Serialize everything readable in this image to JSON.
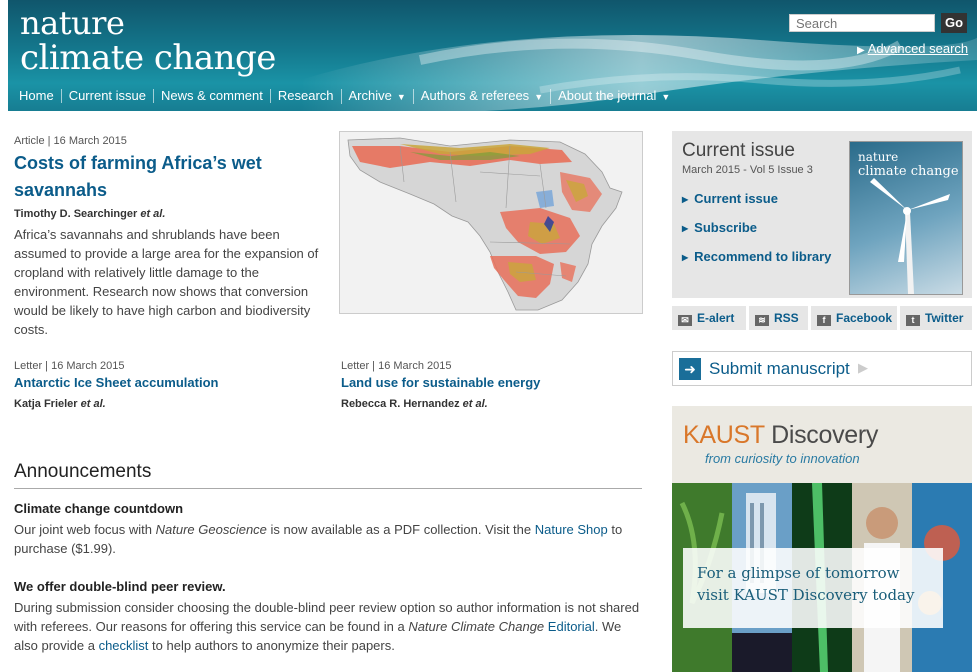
{
  "header": {
    "logo_line1": "nature",
    "logo_line2": "climate change",
    "search_placeholder": "Search",
    "search_button": "Go",
    "advanced_search": "Advanced search",
    "nav": [
      {
        "label": "Home",
        "dropdown": false
      },
      {
        "label": "Current issue",
        "dropdown": false
      },
      {
        "label": "News & comment",
        "dropdown": false
      },
      {
        "label": "Research",
        "dropdown": false
      },
      {
        "label": "Archive",
        "dropdown": true
      },
      {
        "label": "Authors & referees",
        "dropdown": true
      },
      {
        "label": "About the journal",
        "dropdown": true
      }
    ],
    "caret": "▼"
  },
  "lead": {
    "meta": "Article | 16 March 2015",
    "title": "Costs of farming Africa’s wet savannahs",
    "author": "Timothy D. Searchinger",
    "author_suffix": "et al.",
    "abstract": "Africa’s savannahs and shrublands have been assumed to provide a large area for the expansion of cropland with relatively little damage to the environment. Research now shows that conversion would be likely to have high carbon and biodiversity costs."
  },
  "letters": [
    {
      "meta": "Letter | 16 March 2015",
      "title": "Antarctic Ice Sheet accumulation",
      "author": "Katja Frieler",
      "author_suffix": "et al."
    },
    {
      "meta": "Letter | 16 March 2015",
      "title": "Land use for sustainable energy",
      "author": "Rebecca R. Hernandez",
      "author_suffix": "et al."
    }
  ],
  "announcements": {
    "heading": "Announcements",
    "item1": {
      "title": "Climate change countdown",
      "p1": "Our joint web focus with ",
      "em": "Nature Geoscience",
      "p2": " is now available as a PDF collection. Visit the ",
      "link": "Nature Shop",
      "p3": " to purchase ($1.99)."
    },
    "item2": {
      "title": "We offer double-blind peer review.",
      "p1": "During submission consider choosing the double-blind peer review option so author information is not shared with referees. Our reasons for offering this service can be found in a ",
      "em": "Nature Climate Change",
      "link1": "Editorial",
      "p2": ". We also provide a ",
      "link2": "checklist",
      "p3": " to help authors to anonymize their papers."
    }
  },
  "sidebar": {
    "current_issue_title": "Current issue",
    "current_issue_date": "March 2015 - Vol 5 Issue 3",
    "links": [
      "Current issue",
      "Subscribe",
      "Recommend to library"
    ],
    "cover_line1": "nature",
    "cover_line2": "climate change",
    "share": [
      "E-alert",
      "RSS",
      "Facebook",
      "Twitter"
    ],
    "submit_label": "Submit manuscript",
    "ad_title_1": "KAUST",
    "ad_title_2": "Discovery",
    "ad_subtitle": "from curiosity to innovation",
    "ad_line1": "For a glimpse of tomorrow",
    "ad_line2": "visit KAUST Discovery today"
  },
  "colors": {
    "link": "#0b5c8a",
    "header": "#14788d",
    "ad_accent": "#d9772a"
  }
}
